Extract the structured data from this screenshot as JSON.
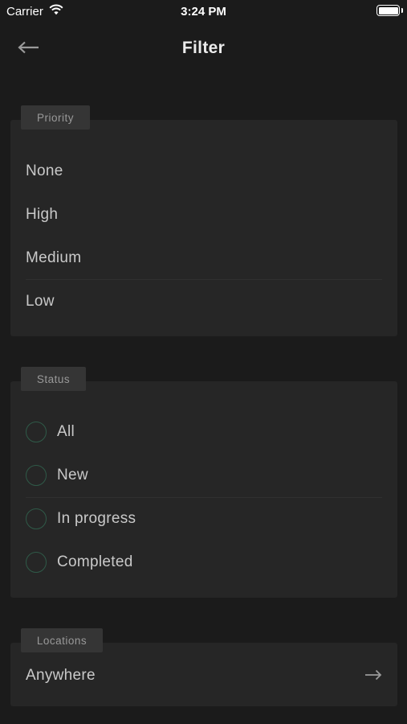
{
  "status_bar": {
    "carrier": "Carrier",
    "time": "3:24 PM",
    "wifi_icon": "wifi-icon",
    "battery_icon": "battery-icon"
  },
  "nav": {
    "title": "Filter",
    "back_icon": "arrow-left-icon"
  },
  "priority": {
    "label": "Priority",
    "options": [
      "None",
      "High",
      "Medium",
      "Low"
    ]
  },
  "status": {
    "label": "Status",
    "options": [
      "All",
      "New",
      "In progress",
      "Completed"
    ],
    "radio_color": "#2f5a48"
  },
  "locations": {
    "label": "Locations",
    "value": "Anywhere",
    "chevron_icon": "arrow-right-icon"
  },
  "colors": {
    "background": "#1b1b1b",
    "card": "#262626",
    "tag": "#353535",
    "accent": "#2f5a48"
  }
}
